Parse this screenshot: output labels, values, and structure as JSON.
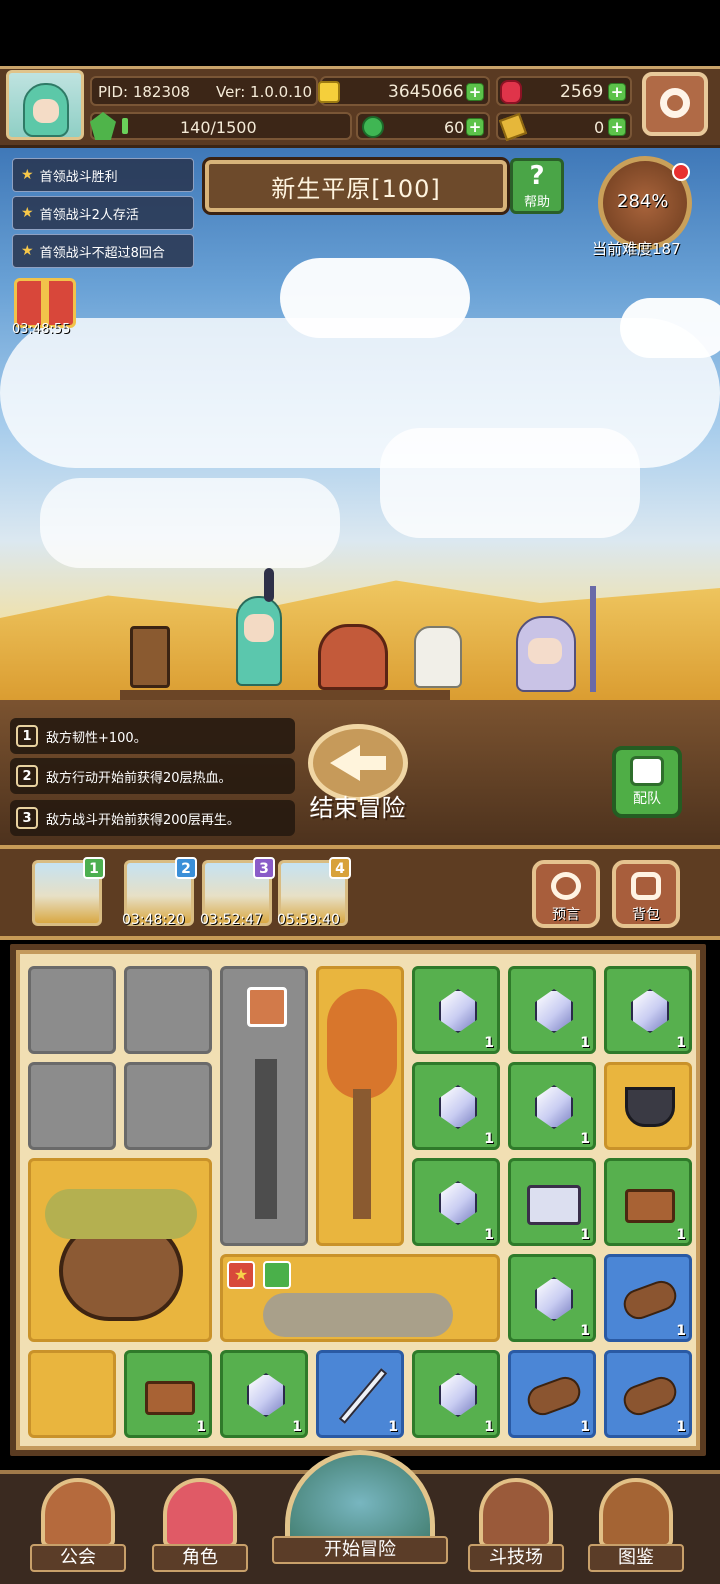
{
  "player": {
    "pid": "PID: 182308",
    "version": "Ver: 1.0.0.10",
    "energy": "140/1500"
  },
  "currencies": {
    "gold": "3645066",
    "ruby": "2569",
    "clover": "60",
    "ticket": "0"
  },
  "quests": [
    {
      "label": "首领战斗胜利"
    },
    {
      "label": "首领战斗2人存活"
    },
    {
      "label": "首领战斗不超过8回合"
    }
  ],
  "gift": {
    "timer": "03:48:55"
  },
  "stage": {
    "title": "新生平原[100]",
    "help_label": "帮助"
  },
  "difficulty": {
    "percent": "284%",
    "label": "当前难度187"
  },
  "effects": [
    {
      "num": "1",
      "text": "敌方韧性+100。"
    },
    {
      "num": "2",
      "text": "敌方行动开始前获得20层热血。"
    },
    {
      "num": "3",
      "text": "敌方战斗开始前获得200层再生。"
    }
  ],
  "actions": {
    "end_adventure": "结束冒险",
    "team": "配队"
  },
  "map_tabs": [
    {
      "num": "1",
      "timer": "",
      "color": "#4caf50"
    },
    {
      "num": "2",
      "timer": "03:48:20",
      "color": "#3a8fd8"
    },
    {
      "num": "3",
      "timer": "03:52:47",
      "color": "#8a5cc8"
    },
    {
      "num": "4",
      "timer": "05:59:40",
      "color": "#d8a23a"
    }
  ],
  "side_buttons": {
    "prophecy": "预言",
    "bag": "背包"
  },
  "grid_counts": {
    "item": "1"
  },
  "nav": [
    {
      "label": "公会"
    },
    {
      "label": "角色"
    },
    {
      "label": "开始冒险"
    },
    {
      "label": "斗技场"
    },
    {
      "label": "图鉴"
    }
  ],
  "colors": {
    "accent_green": "#57b04e",
    "accent_blue": "#4b86d6",
    "frame_brown": "#5a3b21"
  }
}
